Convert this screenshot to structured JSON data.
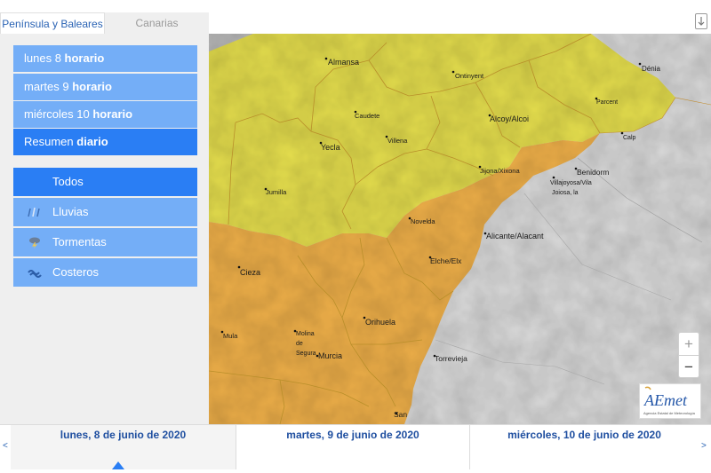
{
  "region_tabs": [
    {
      "label": "Península y Baleares"
    },
    {
      "label": "Canarias"
    }
  ],
  "day_buttons": [
    {
      "day": "lunes 8",
      "mode": "horario"
    },
    {
      "day": "martes 9",
      "mode": "horario"
    },
    {
      "day": "miércoles 10",
      "mode": "horario"
    },
    {
      "day": "Resumen",
      "mode": "diario"
    }
  ],
  "filters": [
    {
      "label": "Todos",
      "icon": "all-warnings"
    },
    {
      "label": "Lluvias",
      "icon": "rain-icon"
    },
    {
      "label": "Tormentas",
      "icon": "storm-icon"
    },
    {
      "label": "Costeros",
      "icon": "waves-icon"
    }
  ],
  "map": {
    "colors": {
      "yellow": "#e4dd4d",
      "orange": "#eeaf49",
      "sea": "#d9d9d9",
      "land_outside": "#b9b9b9"
    },
    "places": [
      "Almansa",
      "Ontinyent",
      "Dénia",
      "Parcent",
      "Caudete",
      "Alcoy/Alcoi",
      "Yecla",
      "Villena",
      "Calp",
      "Jijona/Xixona",
      "Benidorm",
      "Villajoyosa/Vila",
      "Joiosa, la",
      "Jumilla",
      "Novelda",
      "Alicante/Alacant",
      "Elche/Elx",
      "Cieza",
      "Orihuela",
      "Mula",
      "Molina",
      "de",
      "Segura",
      "Murcia",
      "Torrevieja",
      "San"
    ]
  },
  "zoom": {
    "in": "+",
    "out": "−"
  },
  "logo": {
    "text": "AEmet",
    "subtitle": "Agencia Estatal de Meteorología"
  },
  "timeline": {
    "prev": "<",
    "next": ">",
    "days": [
      "lunes, 8 de junio de 2020",
      "martes, 9 de junio de 2020",
      "miércoles, 10 de junio de 2020"
    ]
  }
}
